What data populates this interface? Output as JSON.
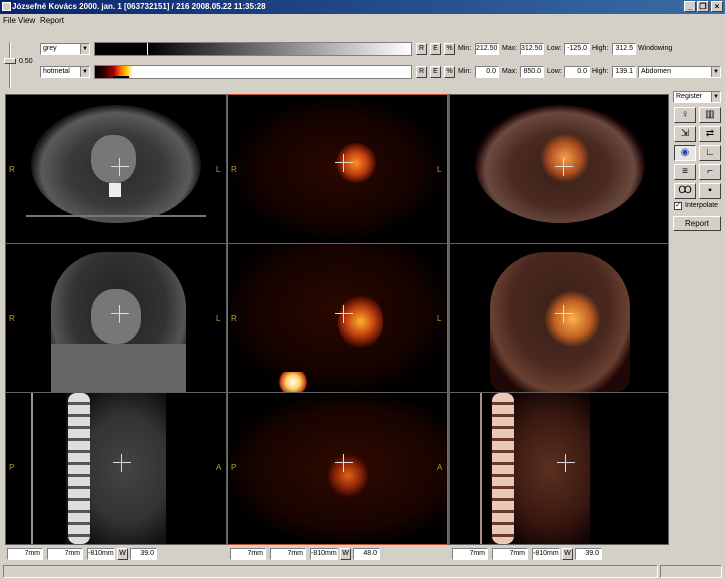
{
  "window": {
    "title": "Józsefné Kovács 2000. jan. 1 [063732151] / 216 2008.05.22 11:35:28"
  },
  "menu": [
    "File",
    "View",
    "Report"
  ],
  "slider": {
    "value": "0.50"
  },
  "row1": {
    "colormap": "grey",
    "r": "R",
    "e": "E",
    "pct": "%",
    "min_label": "Min:",
    "min": "212.50",
    "max_label": "Max:",
    "max": "312.50",
    "low_label": "Low:",
    "low": "-125.0",
    "high_label": "High:",
    "high": "312.5",
    "preset": "Windowing"
  },
  "row2": {
    "colormap": "hotmetal",
    "r": "R",
    "e": "E",
    "pct": "%",
    "min_label": "Min:",
    "min": "0.0",
    "max_label": "Max:",
    "max": "850.0",
    "low_label": "Low:",
    "low": "0.0",
    "high_label": "High:",
    "high": "139.1",
    "preset": "Abdomen"
  },
  "orientation": {
    "axial_left": "R",
    "axial_right": "L",
    "coronal_left": "R",
    "coronal_right": "L",
    "sagittal_left": "P",
    "sagittal_right": "A"
  },
  "side_panel": {
    "mode": "Register",
    "interpolate_label": "Interpolate",
    "interpolate_checked": true,
    "report_button": "Report"
  },
  "columns": [
    {
      "a": "7mm",
      "b": "7mm",
      "c": "-810mm",
      "w": "W",
      "value": "39.0"
    },
    {
      "a": "7mm",
      "b": "7mm",
      "c": "-810mm",
      "w": "W",
      "value": "48.0"
    },
    {
      "a": "7mm",
      "b": "7mm",
      "c": "-810mm",
      "w": "W",
      "value": "39.0"
    }
  ],
  "window_buttons": {
    "minimize": "_",
    "restore": "❐",
    "close": "×"
  }
}
